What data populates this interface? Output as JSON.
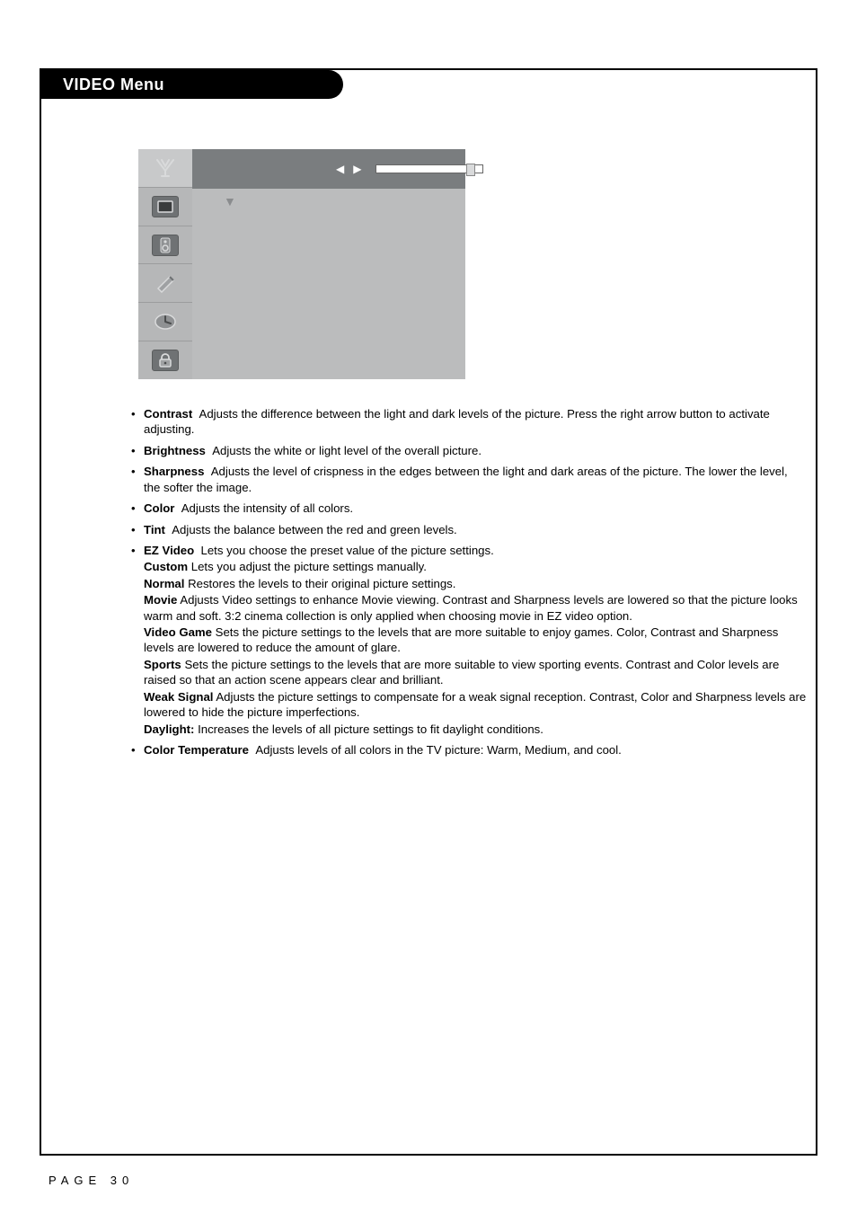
{
  "header": {
    "title": "VIDEO Menu"
  },
  "osd": {
    "sidebar_icons": [
      "antenna-icon",
      "tv-icon",
      "speaker-icon",
      "pen-icon",
      "clock-icon",
      "lock-icon"
    ],
    "selected_index": 0
  },
  "items": [
    {
      "term": "Contrast",
      "desc": "Adjusts the difference between the light and dark levels of the picture. Press the right arrow button to activate adjusting."
    },
    {
      "term": "Brightness",
      "desc": "Adjusts the white or light level of the overall picture."
    },
    {
      "term": "Sharpness",
      "desc": "Adjusts the level of crispness in the edges between the light and dark areas of the picture. The lower the level, the softer the image."
    },
    {
      "term": "Color",
      "desc": "Adjusts the intensity of all colors."
    },
    {
      "term": "Tint",
      "desc": "Adjusts the balance between the red and green levels."
    }
  ],
  "ez": {
    "term": "EZ Video",
    "desc": "Lets you choose the preset value of the picture settings.",
    "subitems": [
      {
        "term": "Custom",
        "desc": "Lets you adjust the picture settings manually."
      },
      {
        "term": "Normal",
        "desc": "Restores the levels to their original picture settings."
      },
      {
        "term": "Movie",
        "desc": "Adjusts Video settings to enhance Movie viewing. Contrast and Sharpness levels are lowered so that the picture looks warm and soft. 3:2 cinema collection is only applied when choosing movie in EZ video option."
      },
      {
        "term": "Video Game",
        "desc": "Sets the picture settings to the levels that are more suitable to enjoy games. Color, Contrast and Sharpness levels are lowered to reduce the amount of glare."
      },
      {
        "term": "Sports",
        "desc": "Sets the picture settings to the levels that are more suitable to view sporting events. Contrast and Color levels are raised so that an action scene appears clear and brilliant."
      },
      {
        "term": "Weak Signal",
        "desc": "Adjusts the picture settings to compensate for a weak signal reception. Contrast, Color and Sharpness levels are lowered to hide the picture imperfections."
      },
      {
        "term": "Daylight:",
        "desc": "Increases the levels of all picture settings to fit daylight conditions."
      }
    ]
  },
  "color_temp": {
    "term": "Color Temperature",
    "desc": "Adjusts levels of all colors in the TV picture: Warm, Medium, and cool."
  },
  "page_label": "PAGE 30"
}
